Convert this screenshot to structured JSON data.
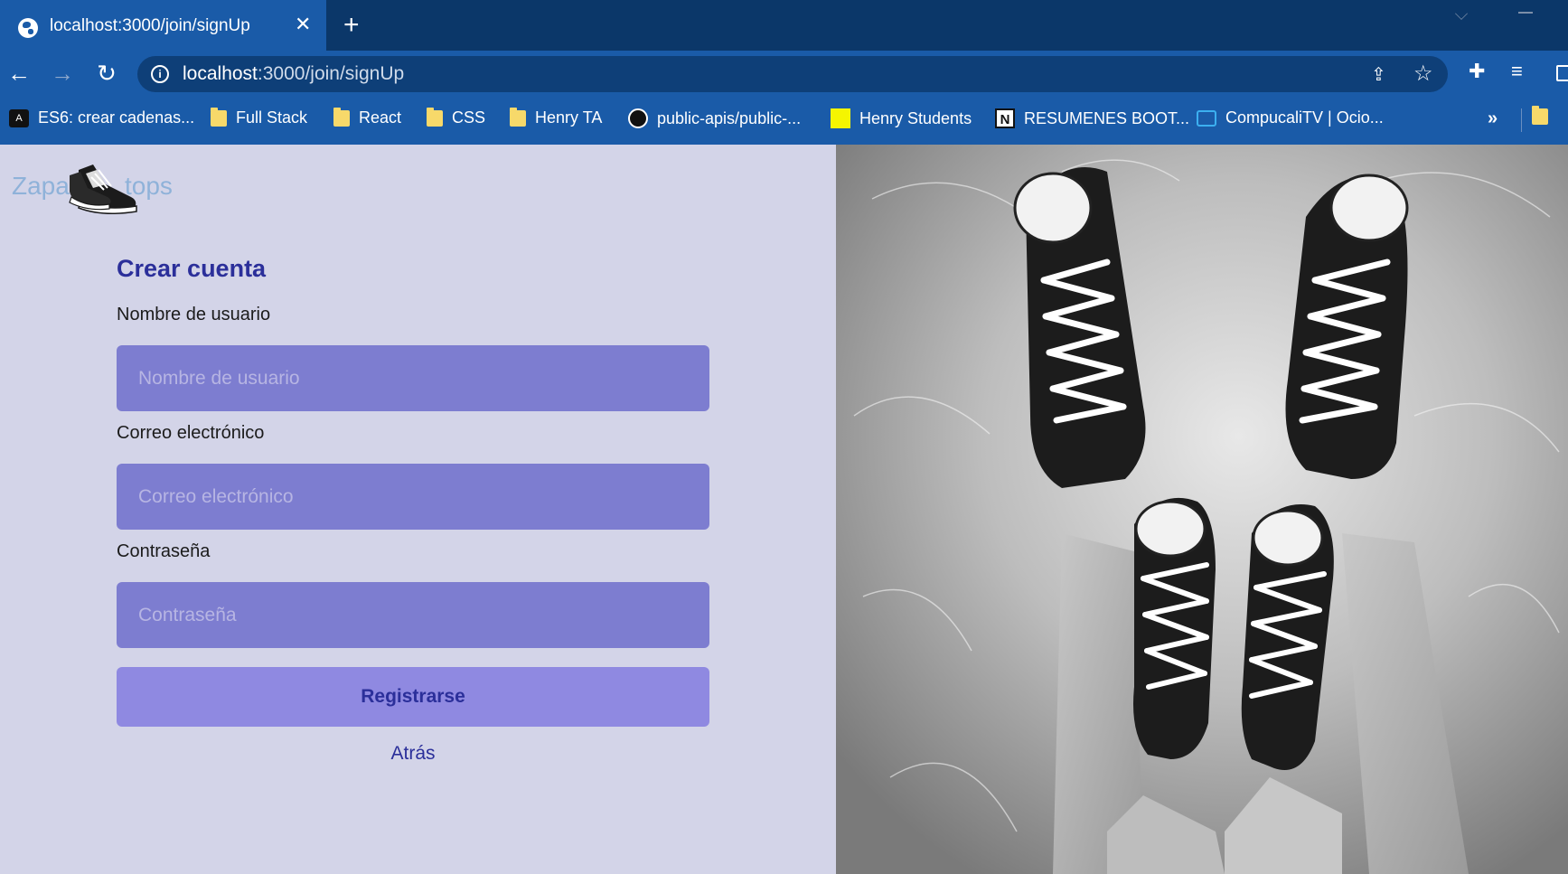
{
  "browser": {
    "tab_title": "localhost:3000/join/signUp",
    "tab_close": "✕",
    "new_tab": "+",
    "url_host": "localhost",
    "url_path": ":3000/join/signUp",
    "icons": [
      "globe-icon",
      "back-arrow-icon",
      "forward-arrow-icon",
      "reload-icon",
      "info-icon",
      "share-icon",
      "star-icon",
      "extensions-icon",
      "media-icon",
      "side-panel-icon"
    ],
    "back": "←",
    "forward": "→",
    "reload": "↻",
    "info": "i",
    "share": "⇪",
    "star": "☆",
    "extensions": "✚",
    "media": "≡",
    "bookmarks_more": "»"
  },
  "bookmarks": {
    "es6": "ES6: crear cadenas...",
    "fullstack": "Full Stack",
    "react": "React",
    "css": "CSS",
    "henry_ta": "Henry TA",
    "public_apis": "public-apis/public-...",
    "henry_students": "Henry Students",
    "resumenes": "RESUMENES BOOT...",
    "compucali": "CompucaliTV | Ocio..."
  },
  "logo": {
    "part1": "Zapa",
    "part2": "tops"
  },
  "form": {
    "title": "Crear cuenta",
    "username_label": "Nombre de usuario",
    "username_placeholder": "Nombre de usuario",
    "email_label": "Correo electrónico",
    "email_placeholder": "Correo electrónico",
    "password_label": "Contraseña",
    "password_placeholder": "Contraseña",
    "submit": "Registrarse",
    "back": "Atrás"
  },
  "colors": {
    "tabbar": "#0b3769",
    "toolbar": "#1a5ba8",
    "page_bg": "#d3d4e8",
    "input_bg": "#7d7dd0",
    "button_bg": "#8f89e1",
    "accent_text": "#2b2f9a",
    "logo_text": "#8fb2d9"
  }
}
